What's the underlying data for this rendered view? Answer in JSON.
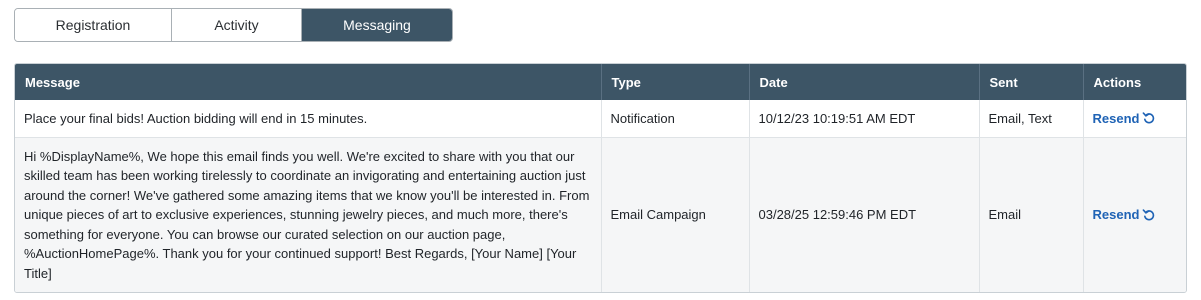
{
  "tabs": [
    {
      "label": "Registration",
      "active": false
    },
    {
      "label": "Activity",
      "active": false
    },
    {
      "label": "Messaging",
      "active": true
    }
  ],
  "table": {
    "headers": {
      "message": "Message",
      "type": "Type",
      "date": "Date",
      "sent": "Sent",
      "actions": "Actions"
    },
    "rows": [
      {
        "message": "Place your final bids! Auction bidding will end in 15 minutes.",
        "type": "Notification",
        "date": "10/12/23 10:19:51 AM EDT",
        "sent": "Email, Text",
        "action_label": "Resend"
      },
      {
        "message": "Hi %DisplayName%, We hope this email finds you well. We're excited to share with you that our skilled team has been working tirelessly to coordinate an invigorating and entertaining auction just around the corner! We've gathered some amazing items that we know you'll be interested in. From unique pieces of art to exclusive experiences, stunning jewelry pieces, and much more, there's something for everyone. You can browse our curated selection on our auction page, %AuctionHomePage%. Thank you for your continued support! Best Regards, [Your Name] [Your Title]",
        "type": "Email Campaign",
        "date": "03/28/25 12:59:46 PM EDT",
        "sent": "Email",
        "action_label": "Resend"
      }
    ]
  },
  "colors": {
    "header_bg": "#3d5566",
    "link": "#1f63b5"
  },
  "icons": {
    "resend": "undo-arrow-icon"
  }
}
